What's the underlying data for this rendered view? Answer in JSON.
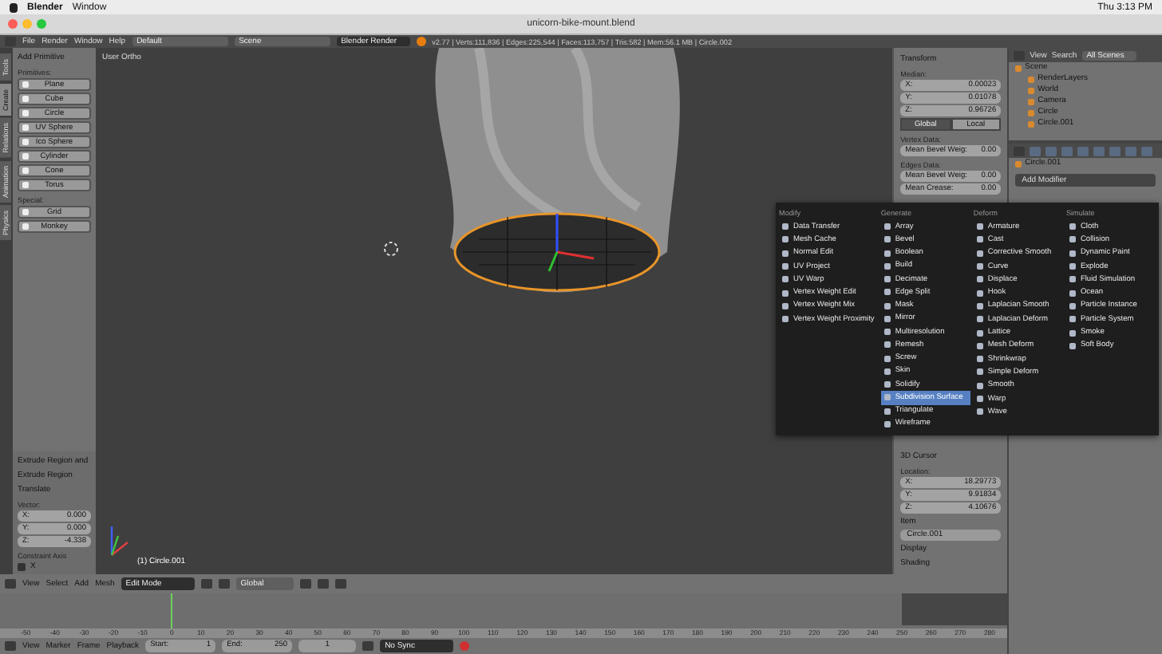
{
  "menubar": {
    "app": "Blender",
    "items": [
      "Window"
    ],
    "clock": "Thu 3:13 PM"
  },
  "window": {
    "title": "unicorn-bike-mount.blend"
  },
  "info_header": {
    "menus": [
      "File",
      "Render",
      "Window",
      "Help"
    ],
    "layout": "Default",
    "scene": "Scene",
    "engine": "Blender Render",
    "stats": "v2.77 | Verts:111,836 | Edges:225,544 | Faces:113,757 | Tris:582 | Mem:56.1 MB | Circle.002"
  },
  "tool_tabs": [
    {
      "label": "Tools",
      "selected": false
    },
    {
      "label": "Create",
      "selected": true
    },
    {
      "label": "Relations",
      "selected": false
    },
    {
      "label": "Animation",
      "selected": false
    },
    {
      "label": "Physics",
      "selected": false
    }
  ],
  "add_panel": {
    "title": "Add Primitive",
    "sections": [
      {
        "heading": "Primitives:",
        "items": [
          "Plane",
          "Cube",
          "Circle",
          "UV Sphere",
          "Ico Sphere",
          "Cylinder",
          "Cone",
          "Torus"
        ]
      },
      {
        "heading": "Special:",
        "items": [
          "Grid",
          "Monkey"
        ]
      }
    ]
  },
  "operator_panel": {
    "title": "Extrude Region and",
    "rows": [
      "Extrude Region",
      "Translate"
    ],
    "vector_label": "Vector:",
    "vector": [
      {
        "axis": "X:",
        "value": "0.000"
      },
      {
        "axis": "Y:",
        "value": "0.000"
      },
      {
        "axis": "Z:",
        "value": "-4.338"
      }
    ],
    "constraint_label": "Constraint Axis",
    "constraint": [
      {
        "axis": "X",
        "checked": false
      }
    ]
  },
  "viewport": {
    "view_label": "User Ortho",
    "object_label": "(1) Circle.001"
  },
  "n_panel": {
    "transform_title": "Transform",
    "median_label": "Median:",
    "median": [
      {
        "axis": "X:",
        "value": "0.00023"
      },
      {
        "axis": "Y:",
        "value": "0.01078"
      },
      {
        "axis": "Z:",
        "value": "0.96726"
      }
    ],
    "spaces": [
      {
        "label": "Global",
        "selected": true
      },
      {
        "label": "Local",
        "selected": false
      }
    ],
    "vertex_label": "Vertex Data:",
    "vertex_fields": [
      {
        "label": "Mean Bevel Weig:",
        "value": "0.00"
      }
    ],
    "edge_label": "Edges Data:",
    "edge_fields": [
      {
        "label": "Mean Bevel Weig:",
        "value": "0.00"
      },
      {
        "label": "Mean Crease:",
        "value": "0.00"
      }
    ],
    "cursor_title": "3D Cursor",
    "location_label": "Location:",
    "location": [
      {
        "axis": "X:",
        "value": "18.29773"
      },
      {
        "axis": "Y:",
        "value": "9.91834"
      },
      {
        "axis": "Z:",
        "value": "4.10676"
      }
    ],
    "item_title": "Item",
    "item_name": "Circle.001",
    "collapsed": [
      "Display",
      "Shading"
    ]
  },
  "outliner": {
    "menus": [
      "View",
      "Search"
    ],
    "filter": "All Scenes",
    "tree": [
      {
        "label": "Scene",
        "children": [
          {
            "label": "RenderLayers"
          },
          {
            "label": "World"
          },
          {
            "label": "Camera"
          },
          {
            "label": "Circle"
          },
          {
            "label": "Circle.001"
          }
        ]
      }
    ]
  },
  "properties": {
    "object": "Circle.001",
    "add_modifier": "Add Modifier"
  },
  "modifier_menu": {
    "columns": [
      {
        "heading": "Modify",
        "items": [
          {
            "label": "Data Transfer",
            "selected": false
          },
          {
            "label": "Mesh Cache",
            "selected": false
          },
          {
            "label": "Normal Edit",
            "selected": false
          },
          {
            "label": "UV Project",
            "selected": false
          },
          {
            "label": "UV Warp",
            "selected": false
          },
          {
            "label": "Vertex Weight Edit",
            "selected": false
          },
          {
            "label": "Vertex Weight Mix",
            "selected": false
          },
          {
            "label": "Vertex Weight Proximity",
            "selected": false
          }
        ]
      },
      {
        "heading": "Generate",
        "items": [
          {
            "label": "Array",
            "selected": false
          },
          {
            "label": "Bevel",
            "selected": false
          },
          {
            "label": "Boolean",
            "selected": false
          },
          {
            "label": "Build",
            "selected": false
          },
          {
            "label": "Decimate",
            "selected": false
          },
          {
            "label": "Edge Split",
            "selected": false
          },
          {
            "label": "Mask",
            "selected": false
          },
          {
            "label": "Mirror",
            "selected": false
          },
          {
            "label": "Multiresolution",
            "selected": false
          },
          {
            "label": "Remesh",
            "selected": false
          },
          {
            "label": "Screw",
            "selected": false
          },
          {
            "label": "Skin",
            "selected": false
          },
          {
            "label": "Solidify",
            "selected": false
          },
          {
            "label": "Subdivision Surface",
            "selected": true
          },
          {
            "label": "Triangulate",
            "selected": false
          },
          {
            "label": "Wireframe",
            "selected": false
          }
        ]
      },
      {
        "heading": "Deform",
        "items": [
          {
            "label": "Armature",
            "selected": false
          },
          {
            "label": "Cast",
            "selected": false
          },
          {
            "label": "Corrective Smooth",
            "selected": false
          },
          {
            "label": "Curve",
            "selected": false
          },
          {
            "label": "Displace",
            "selected": false
          },
          {
            "label": "Hook",
            "selected": false
          },
          {
            "label": "Laplacian Smooth",
            "selected": false
          },
          {
            "label": "Laplacian Deform",
            "selected": false
          },
          {
            "label": "Lattice",
            "selected": false
          },
          {
            "label": "Mesh Deform",
            "selected": false
          },
          {
            "label": "Shrinkwrap",
            "selected": false
          },
          {
            "label": "Simple Deform",
            "selected": false
          },
          {
            "label": "Smooth",
            "selected": false
          },
          {
            "label": "Warp",
            "selected": false
          },
          {
            "label": "Wave",
            "selected": false
          }
        ]
      },
      {
        "heading": "Simulate",
        "items": [
          {
            "label": "Cloth",
            "selected": false
          },
          {
            "label": "Collision",
            "selected": false
          },
          {
            "label": "Dynamic Paint",
            "selected": false
          },
          {
            "label": "Explode",
            "selected": false
          },
          {
            "label": "Fluid Simulation",
            "selected": false
          },
          {
            "label": "Ocean",
            "selected": false
          },
          {
            "label": "Particle Instance",
            "selected": false
          },
          {
            "label": "Particle System",
            "selected": false
          },
          {
            "label": "Smoke",
            "selected": false
          },
          {
            "label": "Soft Body",
            "selected": false
          }
        ]
      }
    ]
  },
  "view3d_header": {
    "menus": [
      "View",
      "Select",
      "Add",
      "Mesh"
    ],
    "mode": "Edit Mode",
    "orientation": "Global"
  },
  "timeline": {
    "ticks": [
      "-50",
      "-40",
      "-30",
      "-20",
      "-10",
      "0",
      "10",
      "20",
      "30",
      "40",
      "50",
      "60",
      "70",
      "80",
      "90",
      "100",
      "110",
      "120",
      "130",
      "140",
      "150",
      "160",
      "170",
      "180",
      "190",
      "200",
      "210",
      "220",
      "230",
      "240",
      "250",
      "260",
      "270",
      "280"
    ]
  },
  "timeline_header": {
    "menus": [
      "View",
      "Marker",
      "Frame",
      "Playback"
    ],
    "start_label": "Start:",
    "start": "1",
    "end_label": "End:",
    "end": "250",
    "current": "1",
    "sync": "No Sync"
  }
}
